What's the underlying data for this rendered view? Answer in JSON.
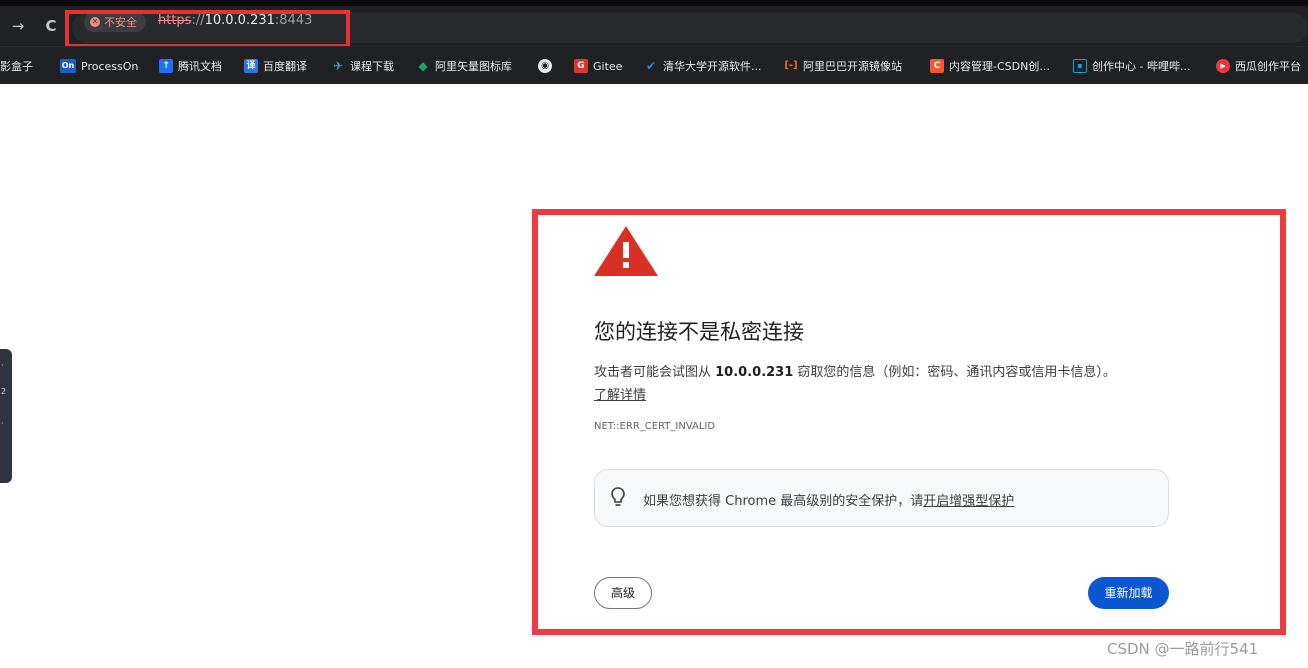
{
  "browser": {
    "back_label": "←",
    "forward_label": "→",
    "reload_label": "C",
    "security_chip": "不安全",
    "url_scheme": "https",
    "url_sep": "://",
    "url_host": "10.0.0.231",
    "url_port": ":8443"
  },
  "bookmarks": [
    {
      "label": "影盒子",
      "icon": "box-icon",
      "color": "#202124"
    },
    {
      "label": "ProcessOn",
      "icon": "processon-icon",
      "color": "#1a5fc7"
    },
    {
      "label": "腾讯文档",
      "icon": "tencent-docs-icon",
      "color": "#1e6fff"
    },
    {
      "label": "百度翻译",
      "icon": "baidu-translate-icon",
      "color": "#2f74e3"
    },
    {
      "label": "课程下载",
      "icon": "download-icon",
      "color": "#3aa0d8"
    },
    {
      "label": "阿里矢量图标库",
      "icon": "iconfont-icon",
      "color": "#1aa36a"
    },
    {
      "label": "",
      "icon": "globe-icon",
      "color": "#e8eaed"
    },
    {
      "label": "Gitee",
      "icon": "gitee-icon",
      "color": "#e0342a"
    },
    {
      "label": "清华大学开源软件...",
      "icon": "tsinghua-icon",
      "color": "#2a86d8"
    },
    {
      "label": "阿里巴巴开源镜像站",
      "icon": "aliyun-icon",
      "color": "#ff6a00"
    },
    {
      "label": "内容管理-CSDN创...",
      "icon": "csdn-icon",
      "color": "#fc5531"
    },
    {
      "label": "创作中心 - 哔哩哔...",
      "icon": "bilibili-icon",
      "color": "#00a1d6"
    },
    {
      "label": "西瓜创作平台",
      "icon": "xigua-icon",
      "color": "#f0363d"
    }
  ],
  "page": {
    "title": "您的连接不是私密连接",
    "desc_before": "攻击者可能会试图从 ",
    "desc_host": "10.0.0.231",
    "desc_after": " 窃取您的信息（例如：密码、通讯内容或信用卡信息）。",
    "learn_more": "了解详情",
    "error_code": "NET::ERR_CERT_INVALID",
    "protect_text": "如果您想获得 Chrome 最高级别的安全保护，请",
    "protect_link": "开启增强型保护",
    "advanced_button": "高级",
    "reload_button": "重新加载"
  },
  "watermark": "CSDN @一路前行541",
  "colors": {
    "warning_red": "#d93025",
    "highlight_red": "#ec3b42",
    "primary_blue": "#0b57d0"
  }
}
